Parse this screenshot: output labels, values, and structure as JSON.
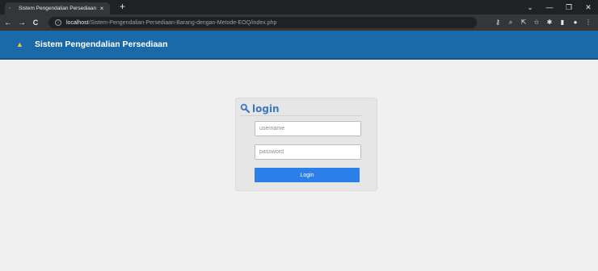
{
  "browser": {
    "tab_title": "Sistem Pengendalian Persediaan",
    "tab_close": "×",
    "new_tab": "+",
    "url_host": "localhost",
    "url_path": "/Sistem-Pengendalian-Persediaan-Barang-dengan-Metode-EOQ/index.php",
    "window_controls": {
      "dropdown": "⌄",
      "minimize": "—",
      "restore": "❐",
      "close": "✕"
    },
    "nav": {
      "back": "←",
      "forward": "→",
      "reload": "C"
    }
  },
  "header": {
    "title": "Sistem Pengendalian Persediaan"
  },
  "login": {
    "title": "login",
    "username_placeholder": "username",
    "password_placeholder": "password",
    "button_label": "Login"
  },
  "colors": {
    "header_bg": "#1a6aa9",
    "login_accent": "#3a7bc0",
    "button_bg": "#2a7fe8"
  }
}
